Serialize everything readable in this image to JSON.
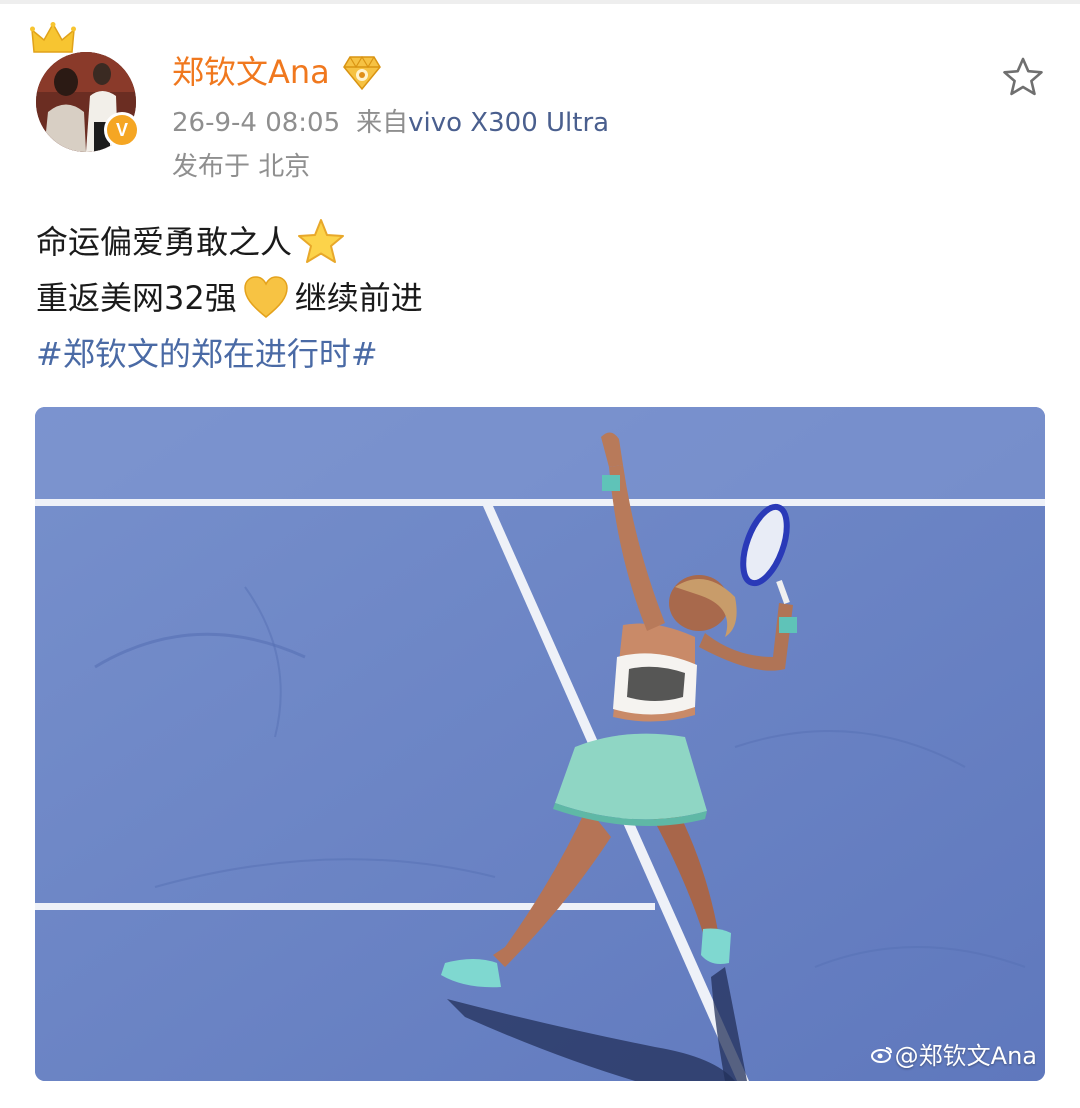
{
  "post": {
    "author": "郑钦文Ana",
    "timestamp": "26-9-4 08:05",
    "source_prefix": "来自",
    "device": "vivo X300 Ultra",
    "location": "发布于 北京",
    "text_lines": [
      "命运偏爱勇敢之人",
      "重返美网32强",
      "继续前进"
    ],
    "hashtag": "#郑钦文的郑在进行时#",
    "image_watermark": "@郑钦文Ana"
  },
  "icons": {
    "favorite": "star-outline-icon",
    "crown": "crown-icon",
    "verified": "verified-v-icon",
    "vip": "vip-member-icon",
    "emoji_star": "star-emoji",
    "emoji_heart": "yellow-heart-emoji"
  },
  "colors": {
    "author": "#f0781e",
    "meta": "#8f8f8f",
    "hashtag": "#4a6aa5",
    "court": "#6f86c7"
  }
}
